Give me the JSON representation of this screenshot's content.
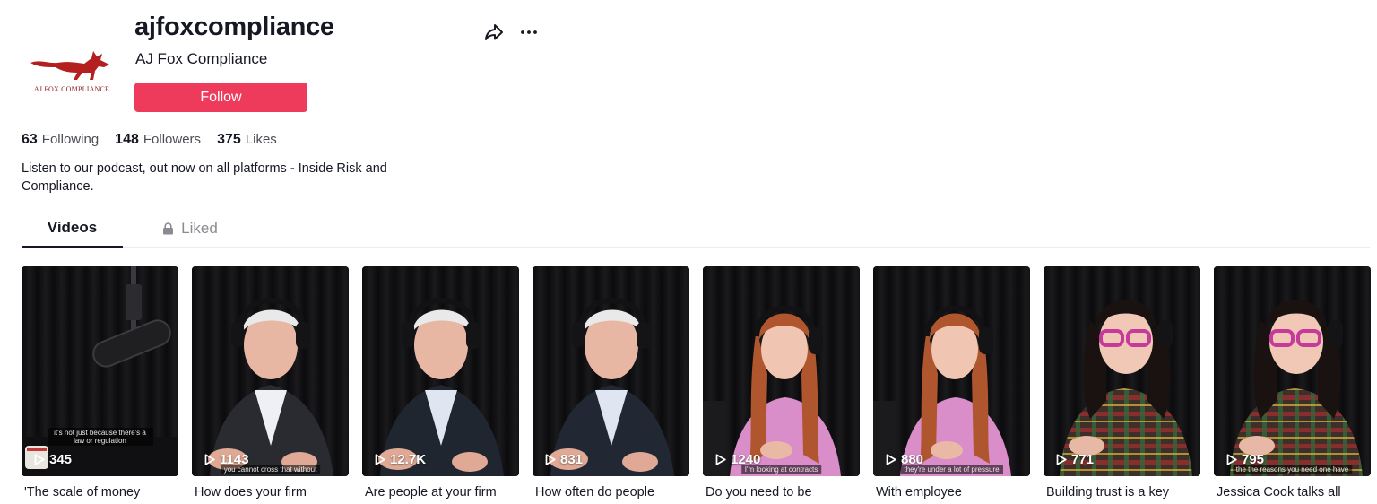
{
  "profile": {
    "username": "ajfoxcompliance",
    "display_name": "AJ Fox Compliance",
    "avatar_text": "AJ FOX COMPLIANCE",
    "follow_label": "Follow",
    "bio": "Listen to our podcast, out now on all platforms - Inside Risk and Compliance."
  },
  "stats": {
    "following": {
      "value": "63",
      "label": "Following"
    },
    "followers": {
      "value": "148",
      "label": "Followers"
    },
    "likes": {
      "value": "375",
      "label": "Likes"
    }
  },
  "tabs": {
    "videos": "Videos",
    "liked": "Liked"
  },
  "icons": {
    "share": "share-icon",
    "more": "more-icon",
    "lock": "lock-icon",
    "play": "play-icon"
  },
  "colors": {
    "follow_button": "#ee3b5b",
    "text": "#161823",
    "muted": "#8a8b91",
    "logo_red": "#b3201f"
  },
  "videos": [
    {
      "views": "345",
      "title": "'The scale of money",
      "caption": "it's not just because there's a law or regulation"
    },
    {
      "views": "1143",
      "title": "How does your firm",
      "caption": "you cannot cross that without"
    },
    {
      "views": "12.7K",
      "title": "Are people at your firm",
      "caption": ""
    },
    {
      "views": "831",
      "title": "How often do people",
      "caption": ""
    },
    {
      "views": "1240",
      "title": "Do you need to be",
      "caption": "I'm looking at contracts"
    },
    {
      "views": "880",
      "title": "With employee",
      "caption": "they're under a lot of pressure"
    },
    {
      "views": "771",
      "title": "Building trust is a key",
      "caption": ""
    },
    {
      "views": "795",
      "title": "Jessica Cook talks all",
      "caption": "the the reasons you need one have"
    }
  ]
}
